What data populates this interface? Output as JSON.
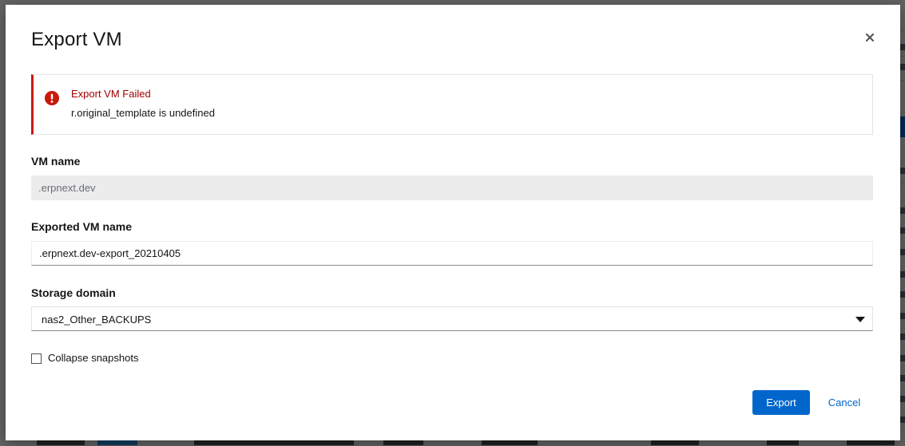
{
  "modal": {
    "title": "Export VM",
    "close_label": "×"
  },
  "alert": {
    "title": "Export VM Failed",
    "message": "r.original_template is undefined",
    "icon": "exclamation-circle-icon",
    "color": "#c9190b"
  },
  "form": {
    "vm_name": {
      "label": "VM name",
      "value": ".erpnext.dev"
    },
    "exported_vm_name": {
      "label": "Exported VM name",
      "value": ".erpnext.dev-export_20210405"
    },
    "storage_domain": {
      "label": "Storage domain",
      "selected": "nas2_Other_BACKUPS"
    },
    "collapse_snapshots": {
      "label": "Collapse snapshots",
      "checked": false
    }
  },
  "actions": {
    "export_label": "Export",
    "cancel_label": "Cancel"
  },
  "colors": {
    "primary": "#0066cc",
    "danger": "#c9190b",
    "danger_text": "#a30000"
  }
}
